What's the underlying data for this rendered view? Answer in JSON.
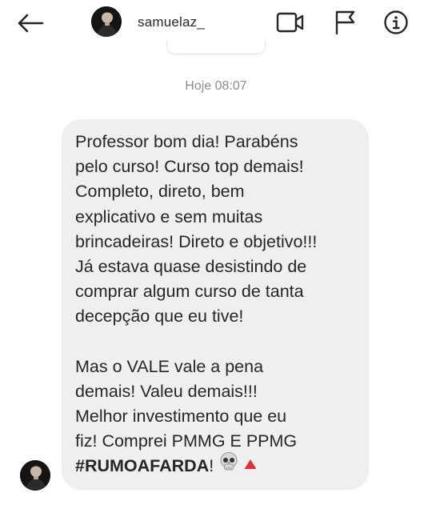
{
  "header": {
    "username": "samuelaz_",
    "icons": {
      "back": "arrow-left-icon",
      "video": "video-camera-icon",
      "flag": "flag-icon",
      "info": "info-icon"
    }
  },
  "timestamp": "Hoje 08:07",
  "message": {
    "lines": [
      "Professor bom dia! Parabéns",
      "pelo curso! Curso top demais!",
      "Completo, direto, bem",
      "explicativo e sem muitas",
      "brincadeiras! Direto e objetivo!!!",
      "Já estava quase desistindo de",
      "comprar algum curso de tanta",
      "decepção que eu tive!",
      "",
      "Mas o VALE vale a pena",
      "demais! Valeu demais!!!",
      "Melhor investimento que eu",
      "fiz! Comprei PMMG E PPMG"
    ],
    "last_line": {
      "hashtag": "#RUMOAFARDA",
      "after": "!",
      "emojis": [
        "skull-icon",
        "red-triangle-icon"
      ]
    }
  },
  "colors": {
    "bubble": "#efefef",
    "text": "#262626",
    "timestamp": "#8e8e8e",
    "triangle": "#e0303a"
  }
}
